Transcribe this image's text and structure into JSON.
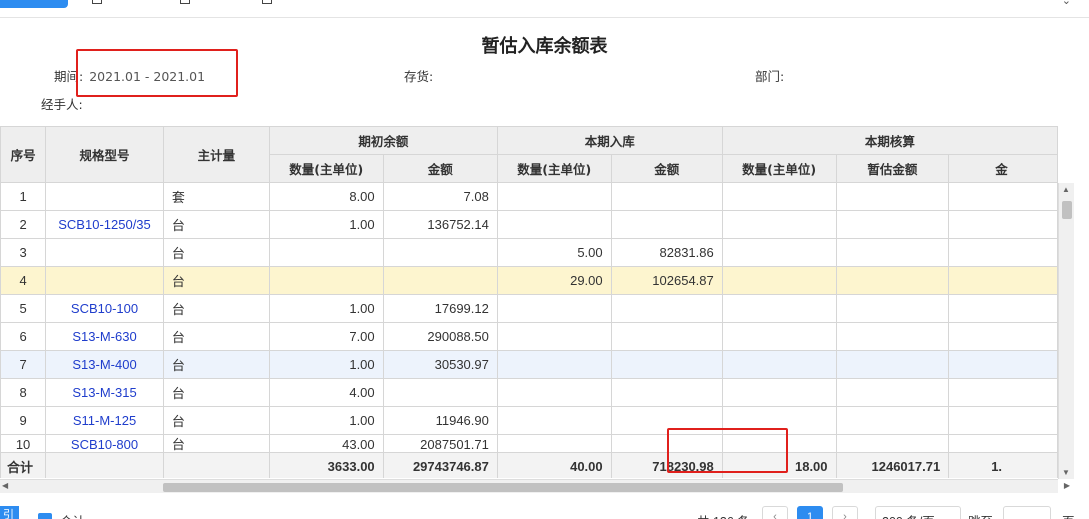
{
  "report": {
    "title": "暂估入库余额表"
  },
  "filters": {
    "period_label": "期间:",
    "period_value": "2021.01 - 2021.01",
    "inventory_label": "存货:",
    "department_label": "部门:",
    "handler_label": "经手人:"
  },
  "table": {
    "headers": {
      "seq": "序号",
      "spec": "规格型号",
      "unit": "主计量",
      "opening_group": "期初余额",
      "inbound_group": "本期入库",
      "checked_group": "本期核算",
      "qty": "数量(主单位)",
      "amount": "金额",
      "est_amount": "暂估金额",
      "cut_amount": "金"
    },
    "rows": [
      {
        "seq": "1",
        "spec": "",
        "unit": "套",
        "open_qty": "8.00",
        "open_amt": "7.08",
        "in_qty": "",
        "in_amt": "",
        "chk_qty": "",
        "chk_amt": ""
      },
      {
        "seq": "2",
        "spec": "SCB10-1250/35",
        "unit": "台",
        "open_qty": "1.00",
        "open_amt": "136752.14",
        "in_qty": "",
        "in_amt": "",
        "chk_qty": "",
        "chk_amt": ""
      },
      {
        "seq": "3",
        "spec": "",
        "unit": "台",
        "open_qty": "",
        "open_amt": "",
        "in_qty": "5.00",
        "in_amt": "82831.86",
        "chk_qty": "",
        "chk_amt": ""
      },
      {
        "seq": "4",
        "spec": "",
        "unit": "台",
        "open_qty": "",
        "open_amt": "",
        "in_qty": "29.00",
        "in_amt": "102654.87",
        "chk_qty": "",
        "chk_amt": ""
      },
      {
        "seq": "5",
        "spec": "SCB10-100",
        "unit": "台",
        "open_qty": "1.00",
        "open_amt": "17699.12",
        "in_qty": "",
        "in_amt": "",
        "chk_qty": "",
        "chk_amt": ""
      },
      {
        "seq": "6",
        "spec": "S13-M-630",
        "unit": "台",
        "open_qty": "7.00",
        "open_amt": "290088.50",
        "in_qty": "",
        "in_amt": "",
        "chk_qty": "",
        "chk_amt": ""
      },
      {
        "seq": "7",
        "spec": "S13-M-400",
        "unit": "台",
        "open_qty": "1.00",
        "open_amt": "30530.97",
        "in_qty": "",
        "in_amt": "",
        "chk_qty": "",
        "chk_amt": ""
      },
      {
        "seq": "8",
        "spec": "S13-M-315",
        "unit": "台",
        "open_qty": "4.00",
        "open_amt": "",
        "in_qty": "",
        "in_amt": "",
        "chk_qty": "",
        "chk_amt": ""
      },
      {
        "seq": "9",
        "spec": "S11-M-125",
        "unit": "台",
        "open_qty": "1.00",
        "open_amt": "11946.90",
        "in_qty": "",
        "in_amt": "",
        "chk_qty": "",
        "chk_amt": ""
      },
      {
        "seq": "10",
        "spec": "SCB10-800",
        "unit": "台",
        "open_qty": "43.00",
        "open_amt": "2087501.71",
        "in_qty": "",
        "in_amt": "",
        "chk_qty": "",
        "chk_amt": ""
      }
    ],
    "total": {
      "label": "合计",
      "open_qty": "3633.00",
      "open_amt": "29743746.87",
      "in_qty": "40.00",
      "in_amt": "718230.98",
      "chk_qty": "18.00",
      "chk_amt": "1246017.71",
      "cut": "1."
    }
  },
  "footer": {
    "left_button": "引",
    "sum_checkbox_label": "合计",
    "total_count": "共 136 条",
    "page_prev": "‹",
    "page_current": "1",
    "page_next": "›",
    "page_size": "200 条/页",
    "jump_label": "跳至",
    "page_suffix": "页"
  },
  "colors": {
    "accent": "#2d8cf0",
    "link": "#1f3dcc",
    "highlight_row": "#fdf5cf",
    "selected_row": "#edf3fc",
    "annotation_box": "#e0201c"
  }
}
